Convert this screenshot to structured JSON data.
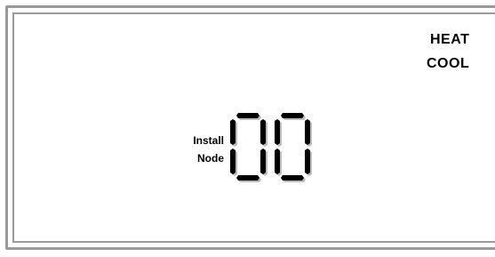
{
  "display": {
    "mode_heat": "HEAT",
    "mode_cool": "COOL",
    "label_line1": "Install",
    "label_line2": "Node",
    "digits": "00",
    "segment_color": "#000000",
    "segment_shadow": "#bdbdbd"
  }
}
